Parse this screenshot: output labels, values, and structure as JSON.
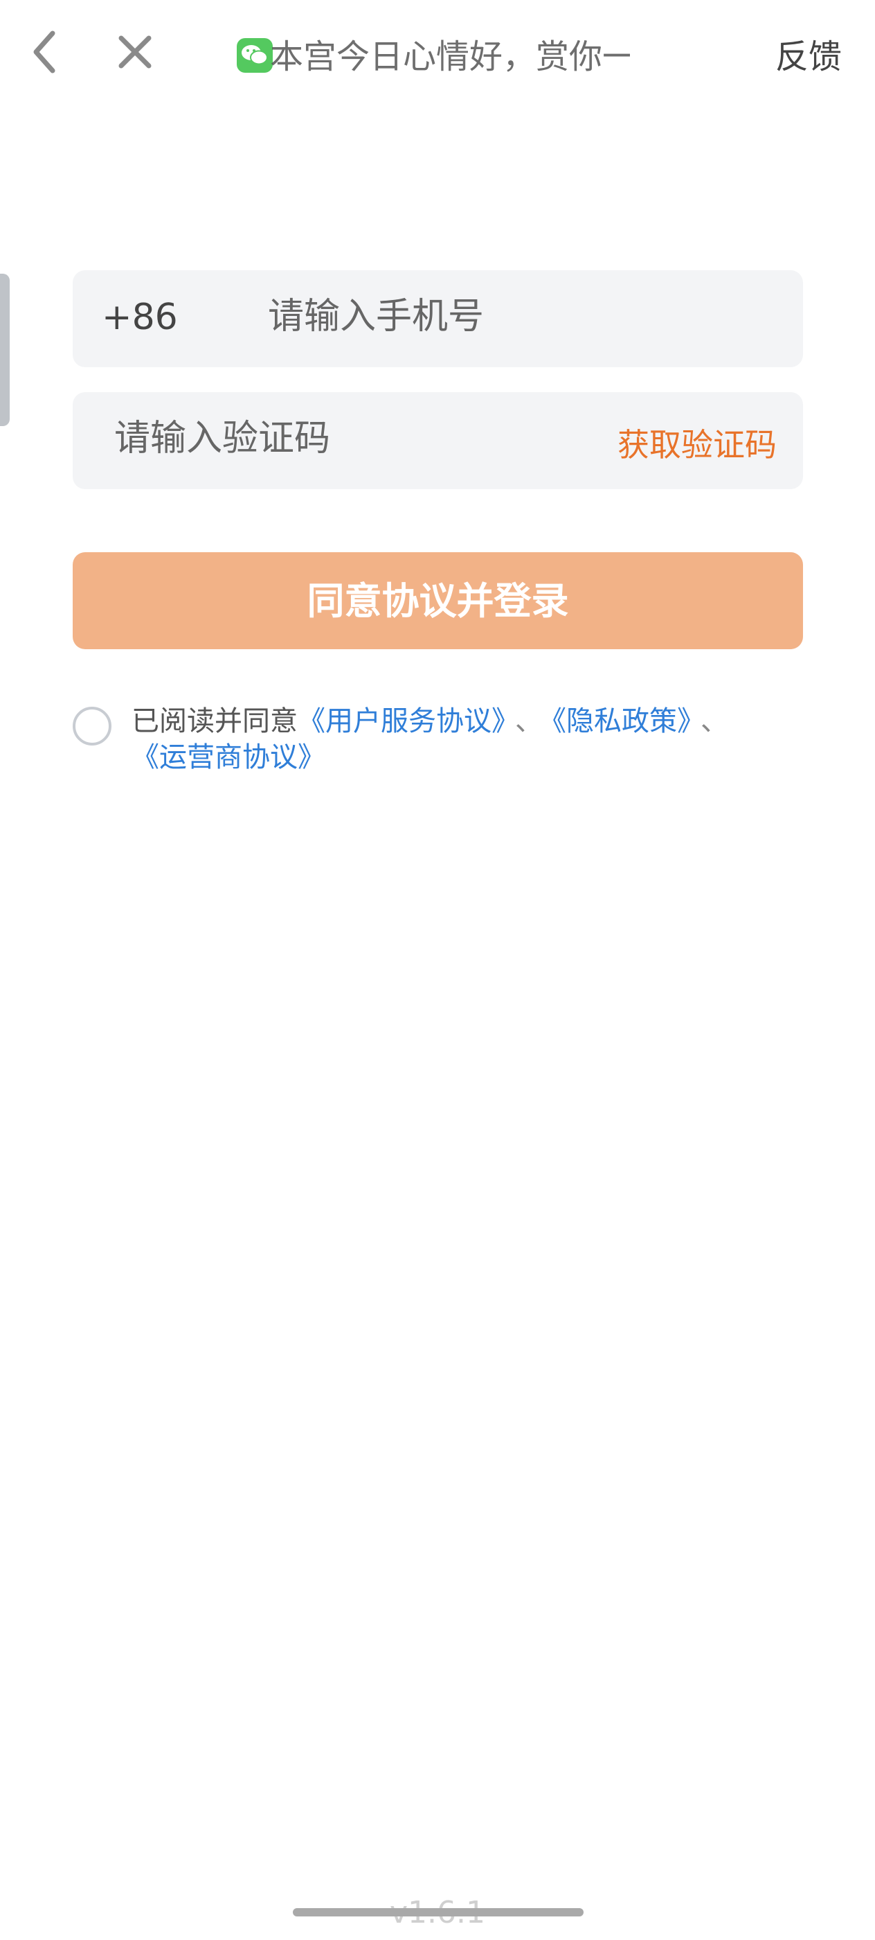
{
  "topbar": {
    "back_icon": "chevron-left-icon",
    "close_icon": "close-icon",
    "wechat_icon": "wechat-icon",
    "marquee_text": "本宫今日心情好，赏你一",
    "feedback_label": "反馈"
  },
  "form": {
    "country_code": "+86",
    "phone_placeholder": "请输入手机号",
    "code_placeholder": "请输入验证码",
    "get_code_label": "获取验证码",
    "login_button_label": "同意协议并登录"
  },
  "agreement": {
    "prefix": "已阅读并同意",
    "user_service": "《用户服务协议》",
    "separator1": "、",
    "privacy": "《隐私政策》",
    "separator2": "、",
    "carrier": "《运营商协议》"
  },
  "footer": {
    "version": "v1.6.1"
  },
  "colors": {
    "accent_orange": "#e8732a",
    "login_button": "#f2b287",
    "link_blue": "#2f7ed8",
    "field_bg": "#f3f4f6"
  }
}
